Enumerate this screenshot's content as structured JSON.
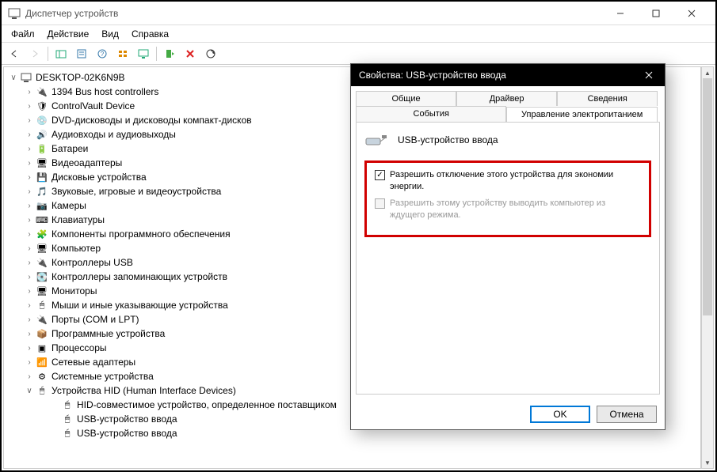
{
  "window": {
    "title": "Диспетчер устройств"
  },
  "menu": {
    "file": "Файл",
    "action": "Действие",
    "view": "Вид",
    "help": "Справка"
  },
  "tree": {
    "root": "DESKTOP-02K6N9B",
    "items": [
      "1394 Bus host controllers",
      "ControlVault Device",
      "DVD-дисководы и дисководы компакт-дисков",
      "Аудиовходы и аудиовыходы",
      "Батареи",
      "Видеоадаптеры",
      "Дисковые устройства",
      "Звуковые, игровые и видеоустройства",
      "Камеры",
      "Клавиатуры",
      "Компоненты программного обеспечения",
      "Компьютер",
      "Контроллеры USB",
      "Контроллеры запоминающих устройств",
      "Мониторы",
      "Мыши и иные указывающие устройства",
      "Порты (COM и LPT)",
      "Программные устройства",
      "Процессоры",
      "Сетевые адаптеры",
      "Системные устройства",
      "Устройства HID (Human Interface Devices)"
    ],
    "hid_children": [
      "HID-совместимое устройство, определенное поставщиком",
      "USB-устройство ввода",
      "USB-устройство ввода"
    ]
  },
  "dialog": {
    "title": "Свойства: USB-устройство ввода",
    "tabs": {
      "general": "Общие",
      "driver": "Драйвер",
      "details": "Сведения",
      "events": "События",
      "power": "Управление электропитанием"
    },
    "device_name": "USB-устройство ввода",
    "check1": "Разрешить отключение этого устройства для экономии энергии.",
    "check2": "Разрешить этому устройству выводить компьютер из ждущего режима.",
    "ok": "OK",
    "cancel": "Отмена"
  }
}
